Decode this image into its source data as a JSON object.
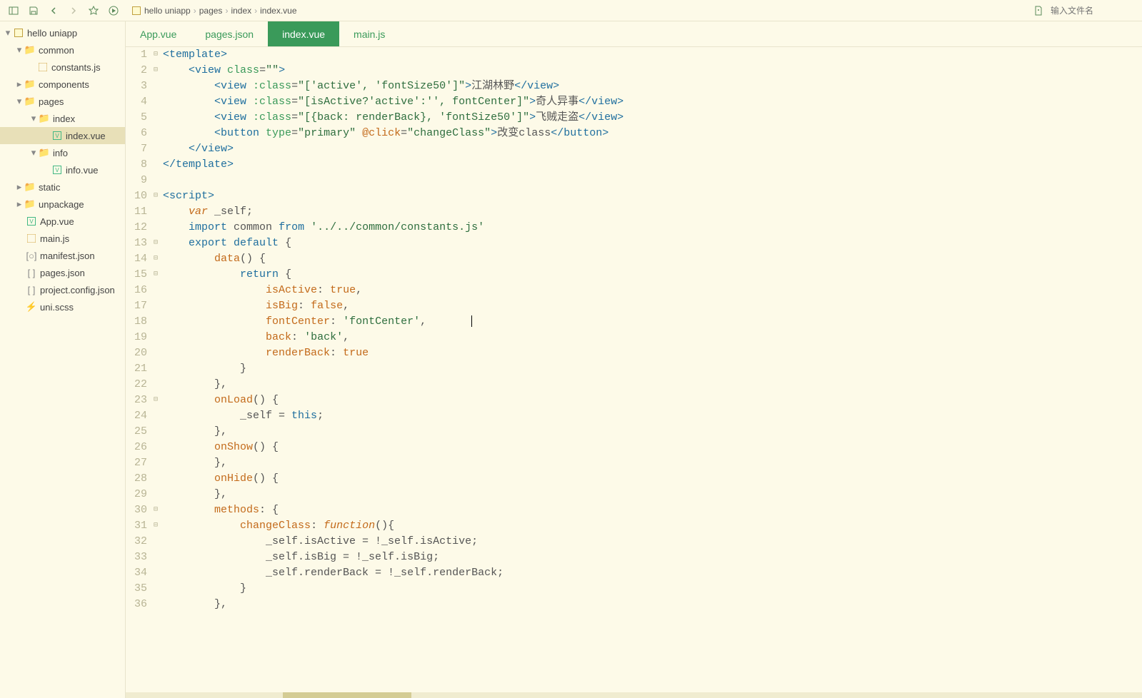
{
  "toolbar": {
    "file_input_placeholder": "输入文件名"
  },
  "breadcrumb": {
    "items": [
      "hello uniapp",
      "pages",
      "index",
      "index.vue"
    ]
  },
  "sidebar": {
    "project": "hello uniapp",
    "items": [
      {
        "label": "common",
        "type": "folder"
      },
      {
        "label": "constants.js",
        "type": "js"
      },
      {
        "label": "components",
        "type": "folder"
      },
      {
        "label": "pages",
        "type": "folder"
      },
      {
        "label": "index",
        "type": "folder"
      },
      {
        "label": "index.vue",
        "type": "vue"
      },
      {
        "label": "info",
        "type": "folder"
      },
      {
        "label": "info.vue",
        "type": "vue"
      },
      {
        "label": "static",
        "type": "folder"
      },
      {
        "label": "unpackage",
        "type": "folder"
      },
      {
        "label": "App.vue",
        "type": "vue"
      },
      {
        "label": "main.js",
        "type": "js"
      },
      {
        "label": "manifest.json",
        "type": "json"
      },
      {
        "label": "pages.json",
        "type": "json"
      },
      {
        "label": "project.config.json",
        "type": "json"
      },
      {
        "label": "uni.scss",
        "type": "scss"
      }
    ]
  },
  "tabs": {
    "items": [
      "App.vue",
      "pages.json",
      "index.vue",
      "main.js"
    ],
    "active": 2
  },
  "editor": {
    "lines": [
      1,
      2,
      3,
      4,
      5,
      6,
      7,
      8,
      9,
      10,
      11,
      12,
      13,
      14,
      15,
      16,
      17,
      18,
      19,
      20,
      21,
      22,
      23,
      24,
      25,
      26,
      27,
      28,
      29,
      30,
      31,
      32,
      33,
      34,
      35,
      36
    ],
    "fold_marks": {
      "1": "⊟",
      "2": "⊟",
      "10": "⊟",
      "13": "⊟",
      "14": "⊟",
      "15": "⊟",
      "23": "⊟",
      "30": "⊟",
      "31": "⊟"
    },
    "code": {
      "l3_text": "江湖林野",
      "l4_text": "奇人异事",
      "l5_text": "飞贼走盗",
      "l6_text": "改变class",
      "l12_path": "'../../common/constants.js'",
      "l16_true": "true",
      "l17_false": "false",
      "l18_font": "'fontCenter'",
      "l19_back": "'back'",
      "l20_true": "true"
    }
  }
}
